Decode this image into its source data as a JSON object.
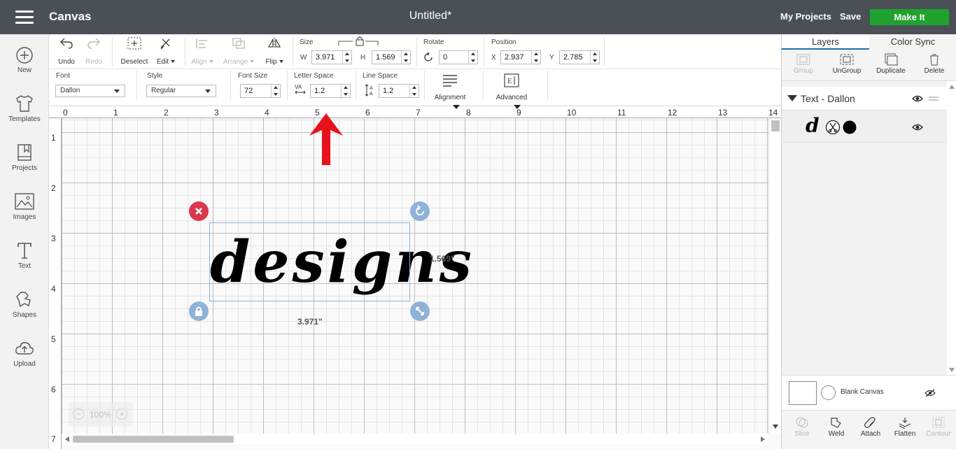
{
  "topbar": {
    "app_title": "Canvas",
    "doc_title": "Untitled*",
    "my_projects": "My Projects",
    "save": "Save",
    "make_it": "Make It"
  },
  "leftbar": {
    "items": [
      {
        "label": "New",
        "icon": "plus-circle-icon"
      },
      {
        "label": "Templates",
        "icon": "shirt-icon"
      },
      {
        "label": "Projects",
        "icon": "bookmark-icon"
      },
      {
        "label": "Images",
        "icon": "image-icon"
      },
      {
        "label": "Text",
        "icon": "text-icon"
      },
      {
        "label": "Shapes",
        "icon": "shapes-icon"
      },
      {
        "label": "Upload",
        "icon": "cloud-upload-icon"
      }
    ]
  },
  "toolbar": {
    "undo": "Undo",
    "redo": "Redo",
    "deselect": "Deselect",
    "edit": "Edit",
    "align": "Align",
    "arrange": "Arrange",
    "flip": "Flip",
    "size_label": "Size",
    "w_label": "W",
    "w_value": "3.971",
    "h_label": "H",
    "h_value": "1.569",
    "rotate_label": "Rotate",
    "rotate_value": "0",
    "position_label": "Position",
    "x_label": "X",
    "x_value": "2.937",
    "y_label": "Y",
    "y_value": "2.785"
  },
  "textbar": {
    "font_label": "Font",
    "font_value": "Dallon",
    "style_label": "Style",
    "style_value": "Regular",
    "font_size_label": "Font Size",
    "font_size_value": "72",
    "letter_space_label": "Letter Space",
    "letter_space_value": "1.2",
    "line_space_label": "Line Space",
    "line_space_value": "1.2",
    "alignment": "Alignment",
    "advanced": "Advanced"
  },
  "canvas": {
    "ruler_top": [
      "0",
      "1",
      "2",
      "3",
      "4",
      "5",
      "6",
      "7",
      "8",
      "9",
      "10",
      "11",
      "12",
      "13",
      "14"
    ],
    "ruler_left": [
      "1",
      "2",
      "3",
      "4",
      "5",
      "6",
      "7"
    ],
    "design_text": "designs",
    "height_label": "1.569\"",
    "width_label": "3.971\"",
    "zoom": "100%"
  },
  "rightpanel": {
    "tabs": [
      "Layers",
      "Color Sync"
    ],
    "actions": [
      "Group",
      "UnGroup",
      "Duplicate",
      "Delete"
    ],
    "layer_group": "Text - Dallon",
    "layer_item_glyph": "d",
    "blank_canvas": "Blank Canvas",
    "bottom_actions": [
      "Slice",
      "Weld",
      "Attach",
      "Flatten",
      "Contour"
    ]
  },
  "colors": {
    "topbar": "#4a5056",
    "make_it": "#1fa22e",
    "delete_handle": "#d9384a",
    "handle": "#8eb2d8",
    "annotation_arrow": "#e8121b"
  }
}
